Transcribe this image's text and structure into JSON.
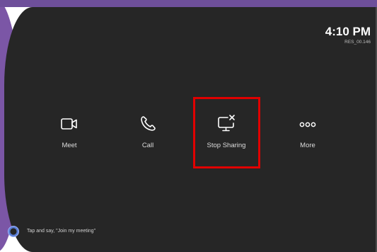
{
  "status": {
    "time": "4:10 PM",
    "device_code": "RES_00.146"
  },
  "actions": [
    {
      "label": "Meet",
      "icon": "video-camera-icon"
    },
    {
      "label": "Call",
      "icon": "phone-icon"
    },
    {
      "label": "Stop Sharing",
      "icon": "stop-sharing-screen-icon",
      "highlighted": true
    },
    {
      "label": "More",
      "icon": "more-dots-icon"
    }
  ],
  "assistant": {
    "icon": "cortana-icon",
    "hint": "Tap and say, \"Join my meeting\""
  },
  "colors": {
    "background": "#262626",
    "accent_purple": "#7b56a6",
    "highlight_red": "#e00000",
    "text": "#ffffff"
  }
}
